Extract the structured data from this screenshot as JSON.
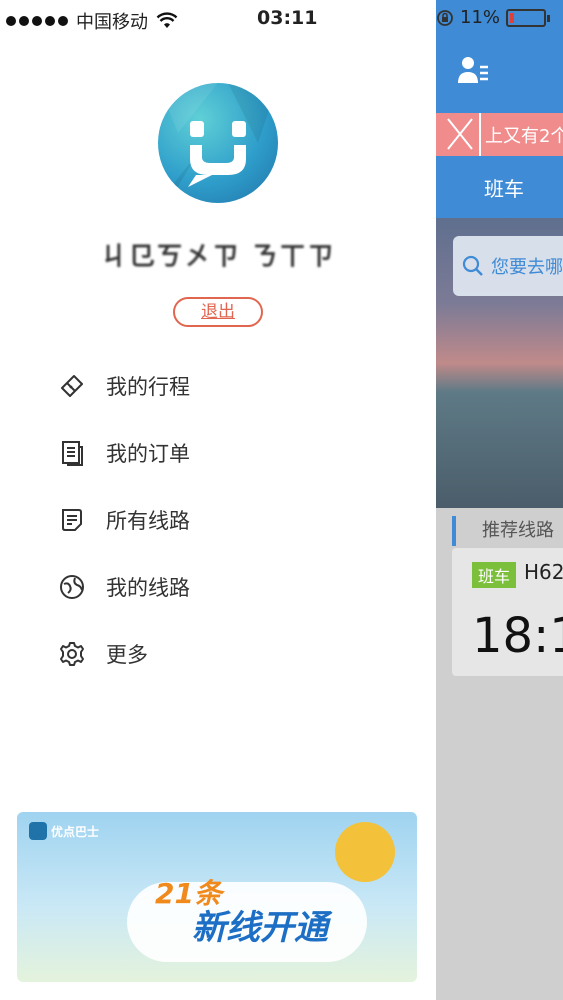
{
  "status_bar": {
    "carrier": "中国移动",
    "time": "03:11",
    "battery": "11%",
    "battery_level": 0.11,
    "icons": [
      "signal-dots-icon",
      "wifi-icon",
      "rotation-lock-icon",
      "battery-icon"
    ]
  },
  "drawer": {
    "username": "ㄐ㔾ㄎ㐅ㄗ ㄋㄒㄗ",
    "logout_label": "退出",
    "menu": [
      {
        "label": "我的行程",
        "icon": "ticket-icon"
      },
      {
        "label": "我的订单",
        "icon": "order-list-icon"
      },
      {
        "label": "所有线路",
        "icon": "routes-icon"
      },
      {
        "label": "我的线路",
        "icon": "my-route-icon"
      },
      {
        "label": "更多",
        "icon": "gear-icon"
      }
    ],
    "banner": {
      "logo_text": "优点巴士",
      "count": "21条",
      "headline": "新线开通"
    }
  },
  "background_app": {
    "alert_text": "上又有2个",
    "tab_label": "班车",
    "search_placeholder": "您要去哪",
    "section_title": "推荐线路",
    "route_tag": "班车",
    "route_name": "H62",
    "departure_time": "18:1"
  },
  "colors": {
    "accent_blue": "#3f8bd6",
    "logout_red": "#e0664f",
    "route_tag_green": "#7cbf3a"
  }
}
